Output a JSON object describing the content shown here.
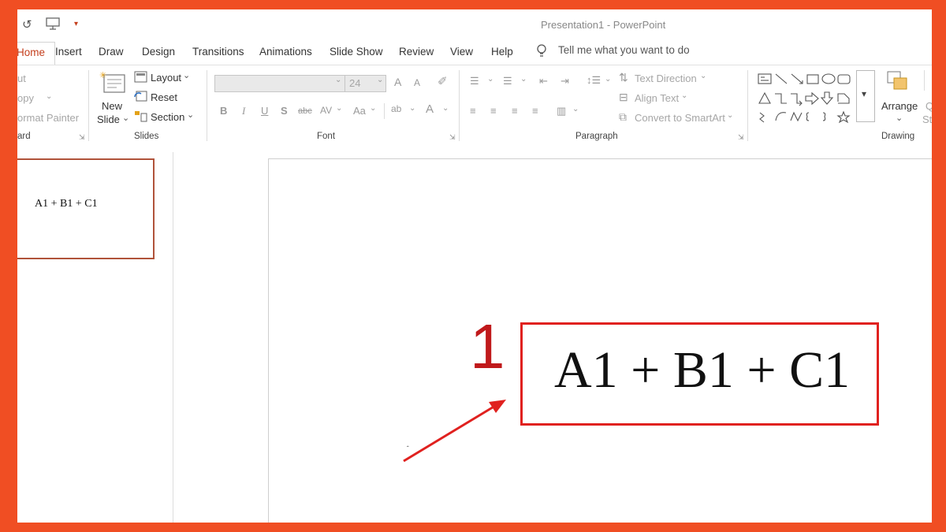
{
  "window": {
    "title": "Presentation1  -  PowerPoint"
  },
  "tabs": [
    "Home",
    "Insert",
    "Draw",
    "Design",
    "Transitions",
    "Animations",
    "Slide Show",
    "Review",
    "View",
    "Help"
  ],
  "tell_me": "Tell me what you want to do",
  "clipboard": {
    "cut": "ut",
    "copy": "opy",
    "format_painter": "ormat Painter",
    "label": "ard"
  },
  "slides_group": {
    "new_slide": "New",
    "new_slide2": "Slide",
    "layout": "Layout",
    "reset": "Reset",
    "section": "Section",
    "label": "Slides"
  },
  "font_group": {
    "font_size": "24",
    "bold": "B",
    "italic": "I",
    "underline": "U",
    "shadow": "S",
    "strike": "abc",
    "spacing": "AV",
    "case": "Aa",
    "grow": "A",
    "shrink": "A",
    "color": "A",
    "label": "Font"
  },
  "paragraph_group": {
    "text_direction": "Text Direction",
    "align_text": "Align Text",
    "smartart": "Convert to SmartArt",
    "label": "Paragraph"
  },
  "drawing_group": {
    "arrange": "Arrange",
    "label": "Drawing",
    "quick": "Q",
    "styles": "St"
  },
  "thumbnail": {
    "text": "A1 + B1 + C1"
  },
  "slide": {
    "text": "A1 + B1 + C1",
    "callout_number": "1"
  },
  "colors": {
    "accent": "#c43e1c",
    "frame": "#f04e23",
    "callout": "#e0211f"
  }
}
